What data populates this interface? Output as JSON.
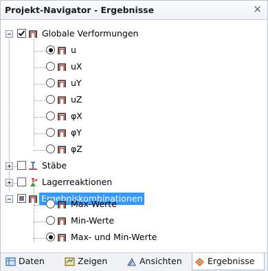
{
  "panel": {
    "title": "Projekt-Navigator - Ergebnisse",
    "close_glyph": "×"
  },
  "tree": {
    "globale": {
      "label": "Globale Verformungen",
      "expanded": true,
      "checked": true,
      "children": [
        {
          "label": "u",
          "selected": true
        },
        {
          "label": "uX",
          "selected": false
        },
        {
          "label": "uY",
          "selected": false
        },
        {
          "label": "uZ",
          "selected": false
        },
        {
          "label": "φX",
          "selected": false
        },
        {
          "label": "φY",
          "selected": false
        },
        {
          "label": "φZ",
          "selected": false
        }
      ]
    },
    "staebe": {
      "label": "Stäbe",
      "expanded": false,
      "checked": false
    },
    "lager": {
      "label": "Lagerreaktionen",
      "expanded": false,
      "checked": false
    },
    "ergebnis": {
      "label": "Ergebniskombinationen",
      "expanded": true,
      "highlighted": true,
      "children": [
        {
          "label": "Max-Werte",
          "selected": false
        },
        {
          "label": "Min-Werte",
          "selected": false
        },
        {
          "label": "Max- und Min-Werte",
          "selected": true
        }
      ]
    }
  },
  "tabs": [
    {
      "label": "Daten",
      "icon": "data-icon",
      "active": false
    },
    {
      "label": "Zeigen",
      "icon": "display-icon",
      "active": false
    },
    {
      "label": "Ansichten",
      "icon": "views-icon",
      "active": false
    },
    {
      "label": "Ergebnisse",
      "icon": "results-icon",
      "active": true
    }
  ],
  "colors": {
    "selection": "#3399ff",
    "accent_red": "#c0392b",
    "icon_blue": "#2a6fb5"
  }
}
